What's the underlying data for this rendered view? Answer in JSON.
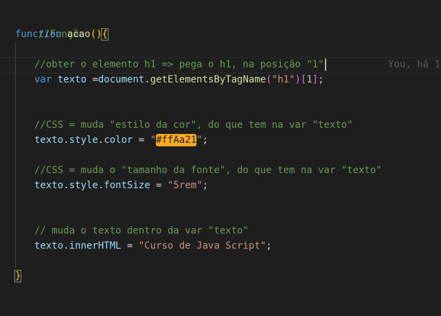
{
  "editor": {
    "lines": {
      "l1_comment": "//Função",
      "l2_keyword": "function",
      "l2_name": "acao",
      "l2_paren": "()",
      "l2_brace": "{",
      "l4_comment": "//obter o elemento h1 => pega o h1, na posição \"1\"",
      "l5_var": "var",
      "l5_ident": "texto",
      "l5_eq": " =",
      "l5_obj": "document",
      "l5_dot": ".",
      "l5_fn": "getElementsByTagName",
      "l5_open": "(",
      "l5_arg": "\"h1\"",
      "l5_close": ")",
      "l5_idx_open": "[",
      "l5_idx": "1",
      "l5_idx_close": "]",
      "l5_semi": ";",
      "l8_comment": "//CSS = muda \"estilo da cor\", do que tem na var \"texto\"",
      "l9_obj": "texto",
      "l9_prop1": "style",
      "l9_prop2": "color",
      "l9_eq": " = ",
      "l9_q1": "\"",
      "l9_color": "#ffAa21",
      "l9_q2": "\"",
      "l9_semi": ";",
      "l11_comment": "//CSS = muda o \"tamanho da fonte\", do que tem na var \"texto\"",
      "l12_obj": "texto",
      "l12_prop1": "style",
      "l12_prop2": "fontSize",
      "l12_eq": " = ",
      "l12_val": "\"5rem\"",
      "l12_semi": ";",
      "l15_comment": "// muda o texto dentro da var \"texto\"",
      "l16_obj": "texto",
      "l16_prop": "innerHTML",
      "l16_eq": " = ",
      "l16_val": "\"Curso de Java Script\"",
      "l16_semi": ";",
      "l18_brace": "}"
    },
    "git_blame": "You, há 1",
    "swatch_color": "#ffaa21"
  }
}
